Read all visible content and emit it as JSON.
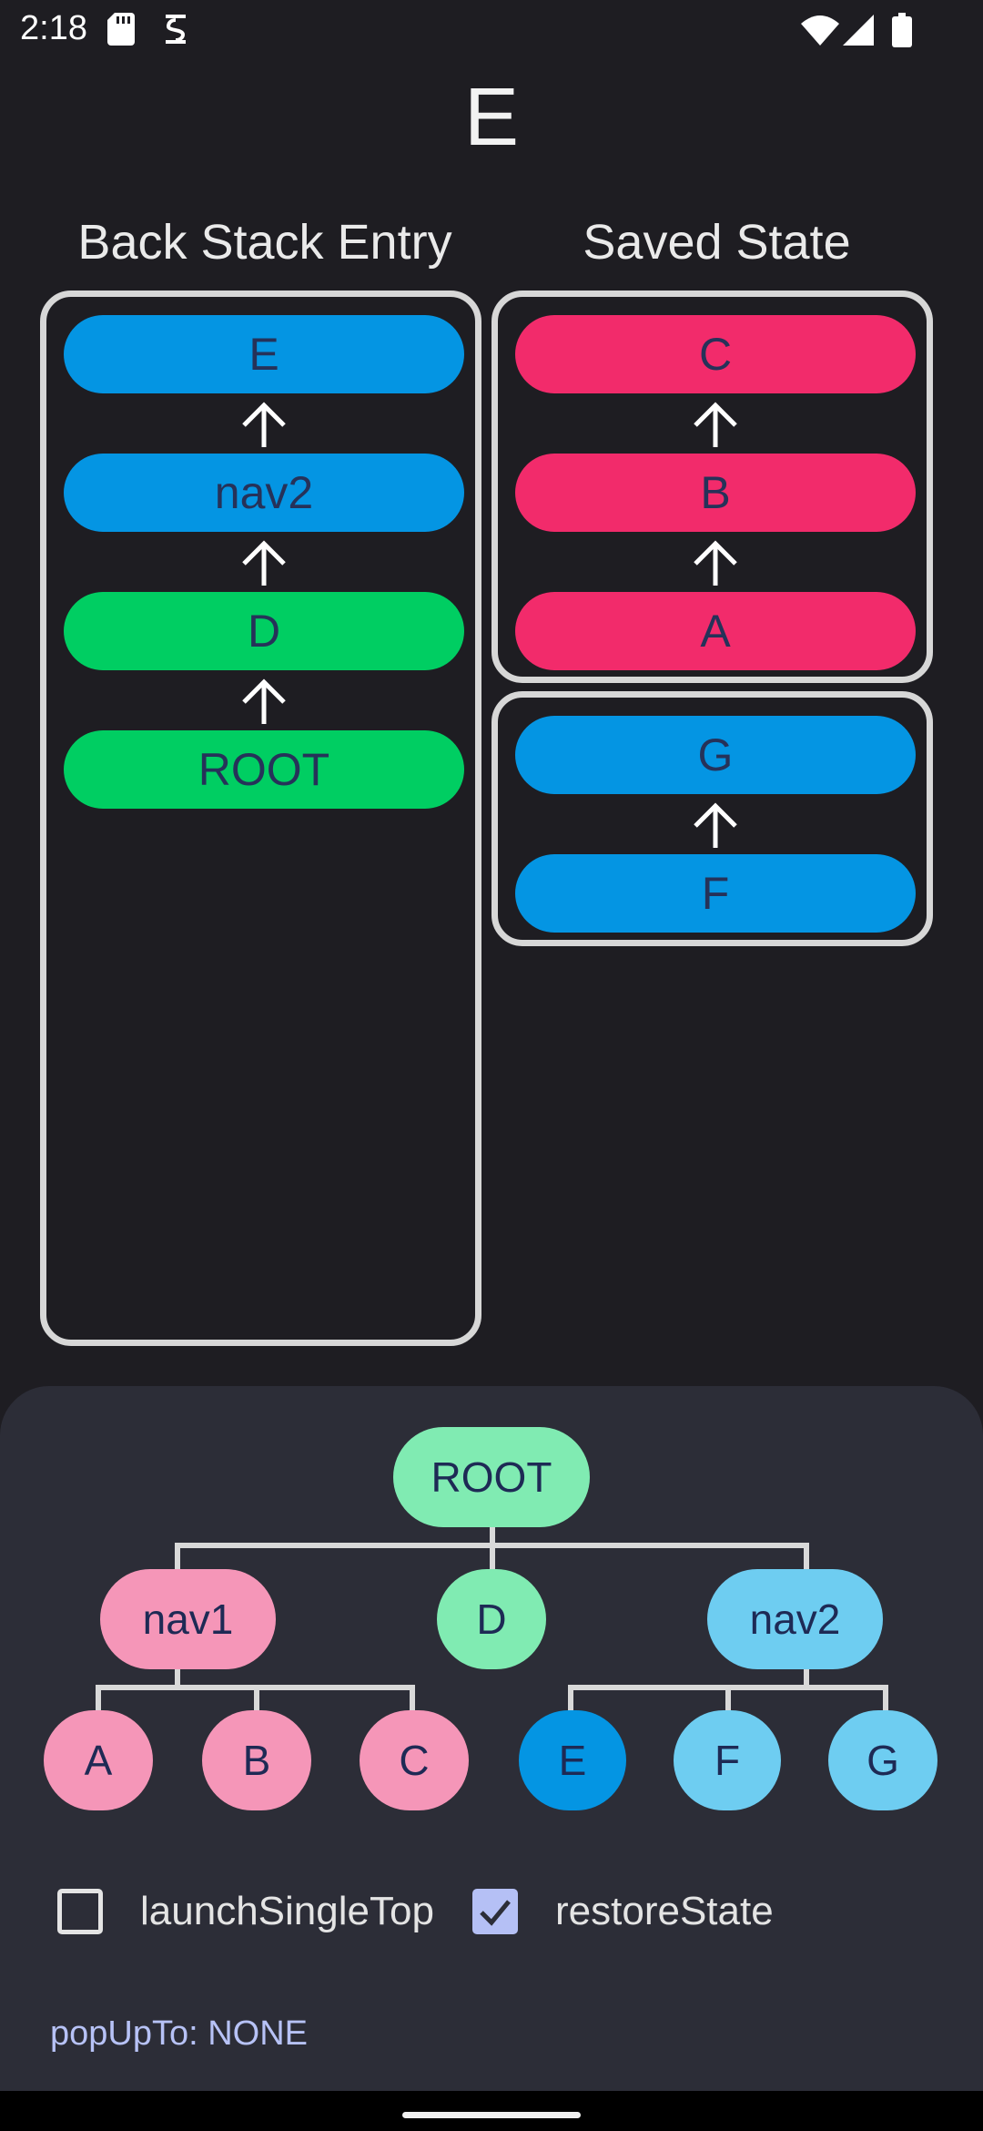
{
  "status_bar": {
    "time": "2:18",
    "icons": [
      "sd-card-icon",
      "debug-icon",
      "wifi-icon",
      "signal-icon",
      "battery-icon"
    ]
  },
  "screen": {
    "title": "E"
  },
  "back_stack": {
    "header": "Back Stack Entry",
    "entries": [
      "E",
      "nav2",
      "D",
      "ROOT"
    ]
  },
  "saved_state": {
    "header": "Saved State",
    "group1": [
      "C",
      "B",
      "A"
    ],
    "group2": [
      "G",
      "F"
    ]
  },
  "graph": {
    "root": "ROOT",
    "level1": [
      "nav1",
      "D",
      "nav2"
    ],
    "level2": [
      "A",
      "B",
      "C",
      "E",
      "F",
      "G"
    ]
  },
  "options": {
    "launch_single_top_label": "launchSingleTop",
    "launch_single_top_checked": false,
    "restore_state_label": "restoreState",
    "restore_state_checked": true,
    "popupto_label": "popUpTo: NONE"
  },
  "colors": {
    "blue": "#0495e3",
    "green": "#00ce62",
    "red": "#f22b6b",
    "node_green": "#80ebb2",
    "node_pink": "#f596b8",
    "node_lightblue": "#6ecdf1",
    "node_selected_blue": "#0495e3",
    "checkbox_checked": "#b5c0f5"
  }
}
